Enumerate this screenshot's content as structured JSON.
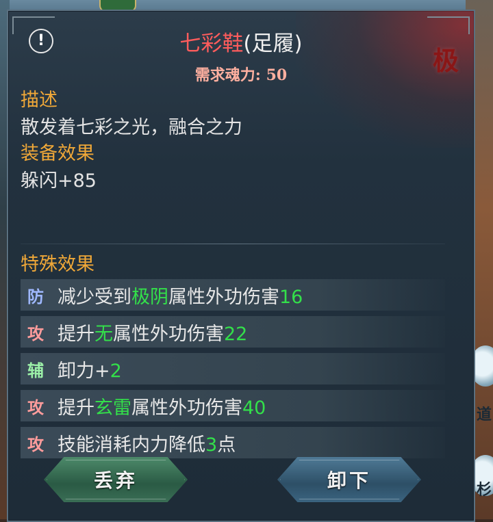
{
  "item": {
    "name": "七彩鞋",
    "slot": "(足履)",
    "requirement": "需求魂力: 50",
    "rank_seal": "极"
  },
  "description": {
    "label": "描述",
    "text": "散发着七彩之光，融合之力"
  },
  "equip_effect": {
    "label": "装备效果",
    "text": "躲闪+85"
  },
  "special": {
    "label": "特殊效果",
    "rows": [
      {
        "tag": "防",
        "pre": "减少受到",
        "hi": "极阴",
        "mid": "属性外功伤害",
        "num": "16",
        "post": ""
      },
      {
        "tag": "攻",
        "pre": "提升",
        "hi": "无",
        "mid": "属性外功伤害",
        "num": "22",
        "post": ""
      },
      {
        "tag": "辅",
        "pre": "卸力+",
        "hi": "",
        "mid": "",
        "num": "2",
        "post": ""
      },
      {
        "tag": "攻",
        "pre": "提升",
        "hi": "玄雷",
        "mid": "属性外功伤害",
        "num": "40",
        "post": ""
      },
      {
        "tag": "攻",
        "pre": "技能消耗内力降低",
        "hi": "",
        "mid": "",
        "num": "3",
        "post": "点"
      }
    ]
  },
  "buttons": {
    "discard": "丢弃",
    "unequip": "卸下"
  },
  "background": {
    "side_text_1": "道",
    "side_text_2": "杉"
  },
  "colors": {
    "item_name": "#ff5c5c",
    "label": "#f0a838",
    "highlight": "#33e04a"
  }
}
